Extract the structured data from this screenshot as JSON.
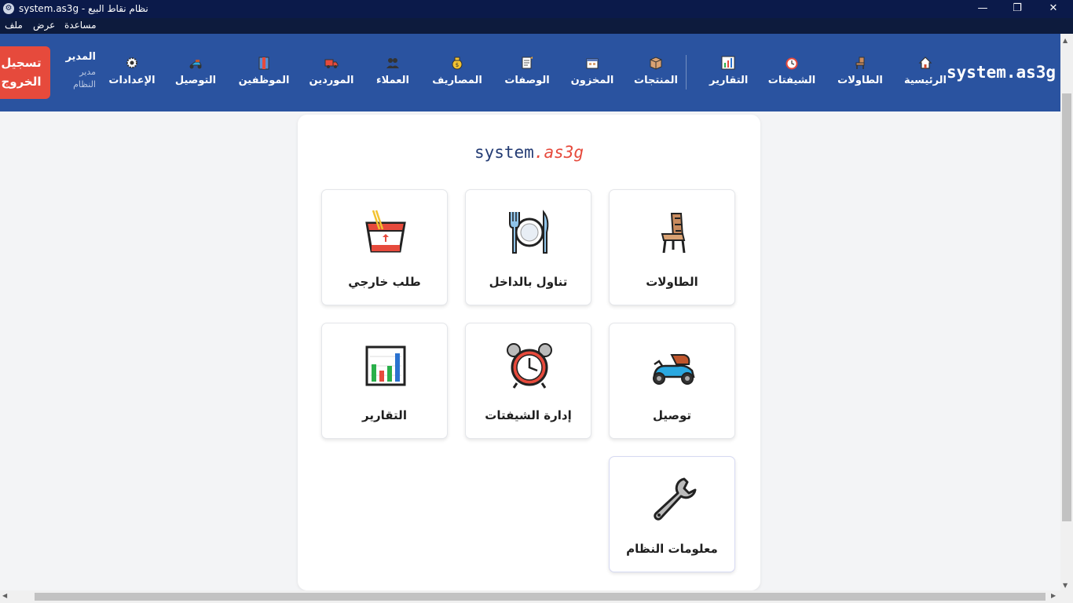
{
  "window": {
    "title": "نظام نقاط البيع - system.as3g",
    "minimize": "—",
    "maximize": "❐",
    "close": "✕"
  },
  "menu": {
    "file": "ملف",
    "view": "عرض",
    "help": "مساعدة"
  },
  "brand": "system.as3g",
  "nav": {
    "home": "الرئيسية",
    "tables": "الطاولات",
    "shifts": "الشيفتات",
    "reports": "التقارير",
    "products": "المنتجات",
    "inventory": "المخزون",
    "recipes": "الوصفات",
    "expenses": "المصاريف",
    "customers": "العملاء",
    "suppliers": "الموردين",
    "employees": "الموظفين",
    "delivery": "التوصيل",
    "settings": "الإعدادات"
  },
  "user": {
    "name": "المدير",
    "role_line1": "مدير",
    "role_line2": "النظام"
  },
  "logout": {
    "line1": "تسجيل",
    "line2": "الخروج"
  },
  "panel": {
    "title_part1": "system",
    "title_part2": ".as3g",
    "tiles": [
      {
        "label": "الطاولات",
        "icon": "chair-icon"
      },
      {
        "label": "تناول بالداخل",
        "icon": "plate-cutlery-icon"
      },
      {
        "label": "طلب خارجي",
        "icon": "takeout-box-icon"
      },
      {
        "label": "توصيل",
        "icon": "scooter-icon"
      },
      {
        "label": "إدارة الشيفتات",
        "icon": "alarm-clock-icon"
      },
      {
        "label": "التقارير",
        "icon": "bar-chart-icon"
      },
      {
        "label": "معلومات النظام",
        "icon": "wrench-icon"
      }
    ]
  },
  "colors": {
    "navbar": "#2a53a0",
    "titlebar": "#0b1a4a",
    "logout": "#e64a3c",
    "accent_red": "#e64a3c",
    "brand_blue": "#243c74"
  }
}
